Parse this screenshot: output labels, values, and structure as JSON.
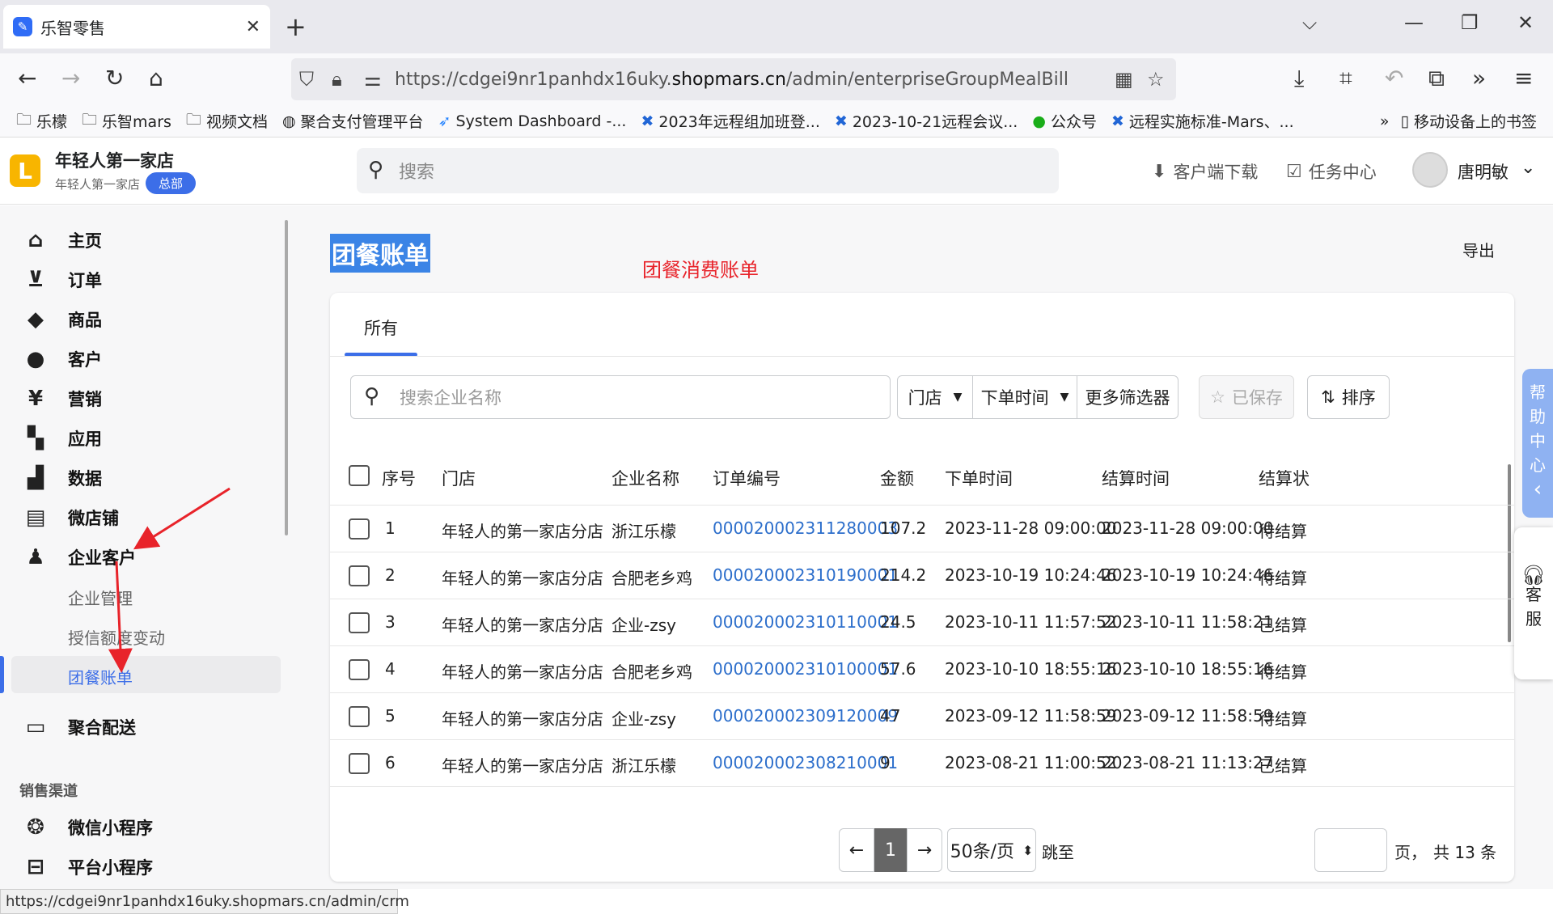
{
  "browser": {
    "tab_title": "乐智零售",
    "favicon": "✎",
    "url_prefix": "https://cdgei9nr1panhdx16uky.",
    "url_domain": "shopmars.cn",
    "url_suffix": "/admin/enterpriseGroupMealBill",
    "bookmarks": [
      {
        "icon": "folder-icon",
        "label": "乐檬"
      },
      {
        "icon": "folder-icon",
        "label": "乐智mars"
      },
      {
        "icon": "folder-icon",
        "label": "视频文档"
      },
      {
        "icon": "globe-icon",
        "label": "聚合支付管理平台"
      },
      {
        "icon": "jira-icon",
        "label": "System Dashboard -..."
      },
      {
        "icon": "confluence-icon",
        "label": "2023年远程组加班登..."
      },
      {
        "icon": "confluence-icon",
        "label": "2023-10-21远程会议..."
      },
      {
        "icon": "wechat-icon",
        "label": "公众号"
      },
      {
        "icon": "confluence-icon",
        "label": "远程实施标准-Mars、..."
      }
    ],
    "mobile_bookmarks": "移动设备上的书签",
    "status_url": "https://cdgei9nr1panhdx16uky.shopmars.cn/admin/crm"
  },
  "header": {
    "logo_letter": "L",
    "store_name": "年轻人第一家店",
    "store_sub": "年轻人第一家店",
    "hq_badge": "总部",
    "search_placeholder": "搜索",
    "client_download": "客户端下载",
    "task_center": "任务中心",
    "user_name": "唐明敏"
  },
  "sidebar": {
    "items": [
      {
        "icon": "home-icon",
        "label": "主页"
      },
      {
        "icon": "order-icon",
        "label": "订单"
      },
      {
        "icon": "tag-icon",
        "label": "商品"
      },
      {
        "icon": "person-icon",
        "label": "客户"
      },
      {
        "icon": "yen-icon",
        "label": "营销"
      },
      {
        "icon": "apps-icon",
        "label": "应用"
      },
      {
        "icon": "chart-icon",
        "label": "数据"
      },
      {
        "icon": "store-icon",
        "label": "微店铺"
      },
      {
        "icon": "enterprise-icon",
        "label": "企业客户"
      }
    ],
    "sub_items": [
      "企业管理",
      "授信额度变动",
      "团餐账单"
    ],
    "delivery": {
      "icon": "monitor-icon",
      "label": "聚合配送"
    },
    "channels_heading": "销售渠道",
    "channels": [
      {
        "icon": "miniprogram-icon",
        "label": "微信小程序"
      },
      {
        "icon": "platform-icon",
        "label": "平台小程序"
      }
    ]
  },
  "page": {
    "title": "团餐账单",
    "annotation": "团餐消费账单",
    "export_label": "导出",
    "tab_all": "所有",
    "filter_search_placeholder": "搜索企业名称",
    "filter_store": "门店",
    "filter_order_time": "下单时间",
    "filter_more": "更多筛选器",
    "saved_label": "已保存",
    "sort_label": "排序"
  },
  "table": {
    "headers": [
      "序号",
      "门店",
      "企业名称",
      "订单编号",
      "金额",
      "下单时间",
      "结算时间",
      "结算状"
    ],
    "rows": [
      [
        "1",
        "年轻人的第一家店分店",
        "浙江乐檬",
        "000020002311280003",
        "107.2",
        "2023-11-28 09:00:00",
        "2023-11-28 09:00:00",
        "待结算"
      ],
      [
        "2",
        "年轻人的第一家店分店",
        "合肥老乡鸡",
        "000020002310190001",
        "214.2",
        "2023-10-19 10:24:46",
        "2023-10-19 10:24:46",
        "待结算"
      ],
      [
        "3",
        "年轻人的第一家店分店",
        "企业-zsy",
        "000020002310110001",
        "24.5",
        "2023-10-11 11:57:52",
        "2023-10-11 11:58:21",
        "已结算"
      ],
      [
        "4",
        "年轻人的第一家店分店",
        "合肥老乡鸡",
        "000020002310100001",
        "57.6",
        "2023-10-10 18:55:16",
        "2023-10-10 18:55:16",
        "待结算"
      ],
      [
        "5",
        "年轻人的第一家店分店",
        "企业-zsy",
        "000020002309120009",
        "47",
        "2023-09-12 11:58:59",
        "2023-09-12 11:58:59",
        "待结算"
      ],
      [
        "6",
        "年轻人的第一家店分店",
        "浙江乐檬",
        "000020002308210001",
        "9",
        "2023-08-21 11:00:52",
        "2023-08-21 11:13:27",
        "已结算"
      ]
    ]
  },
  "pagination": {
    "current_page": "1",
    "page_size": "50条/页",
    "jump_to": "跳至",
    "page_unit": "页，",
    "total": "共 13 条"
  },
  "floating": {
    "help_chars": [
      "帮",
      "助",
      "中",
      "心"
    ],
    "help_chevron": "‹",
    "service_chars": [
      "客",
      "服"
    ]
  },
  "colors": {
    "accent": "#3c6ee8",
    "link": "#2c6ecb",
    "annotation": "#e8232a",
    "logo": "#f8b500"
  }
}
